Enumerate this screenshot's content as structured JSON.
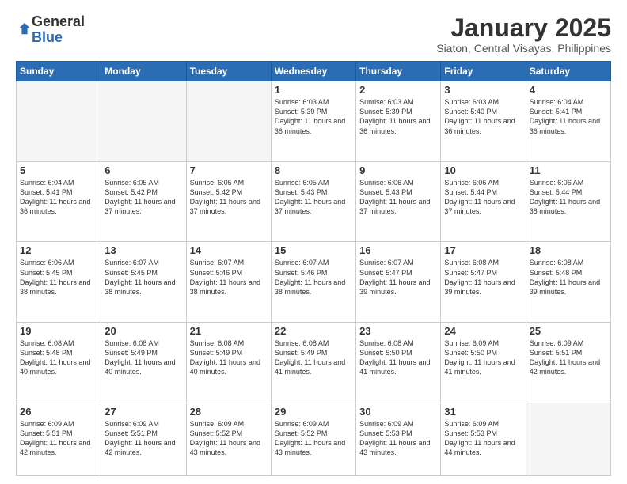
{
  "logo": {
    "general": "General",
    "blue": "Blue"
  },
  "header": {
    "title": "January 2025",
    "location": "Siaton, Central Visayas, Philippines"
  },
  "weekdays": [
    "Sunday",
    "Monday",
    "Tuesday",
    "Wednesday",
    "Thursday",
    "Friday",
    "Saturday"
  ],
  "weeks": [
    [
      {
        "day": "",
        "sunrise": "",
        "sunset": "",
        "daylight": ""
      },
      {
        "day": "",
        "sunrise": "",
        "sunset": "",
        "daylight": ""
      },
      {
        "day": "",
        "sunrise": "",
        "sunset": "",
        "daylight": ""
      },
      {
        "day": "1",
        "sunrise": "Sunrise: 6:03 AM",
        "sunset": "Sunset: 5:39 PM",
        "daylight": "Daylight: 11 hours and 36 minutes."
      },
      {
        "day": "2",
        "sunrise": "Sunrise: 6:03 AM",
        "sunset": "Sunset: 5:39 PM",
        "daylight": "Daylight: 11 hours and 36 minutes."
      },
      {
        "day": "3",
        "sunrise": "Sunrise: 6:03 AM",
        "sunset": "Sunset: 5:40 PM",
        "daylight": "Daylight: 11 hours and 36 minutes."
      },
      {
        "day": "4",
        "sunrise": "Sunrise: 6:04 AM",
        "sunset": "Sunset: 5:41 PM",
        "daylight": "Daylight: 11 hours and 36 minutes."
      }
    ],
    [
      {
        "day": "5",
        "sunrise": "Sunrise: 6:04 AM",
        "sunset": "Sunset: 5:41 PM",
        "daylight": "Daylight: 11 hours and 36 minutes."
      },
      {
        "day": "6",
        "sunrise": "Sunrise: 6:05 AM",
        "sunset": "Sunset: 5:42 PM",
        "daylight": "Daylight: 11 hours and 37 minutes."
      },
      {
        "day": "7",
        "sunrise": "Sunrise: 6:05 AM",
        "sunset": "Sunset: 5:42 PM",
        "daylight": "Daylight: 11 hours and 37 minutes."
      },
      {
        "day": "8",
        "sunrise": "Sunrise: 6:05 AM",
        "sunset": "Sunset: 5:43 PM",
        "daylight": "Daylight: 11 hours and 37 minutes."
      },
      {
        "day": "9",
        "sunrise": "Sunrise: 6:06 AM",
        "sunset": "Sunset: 5:43 PM",
        "daylight": "Daylight: 11 hours and 37 minutes."
      },
      {
        "day": "10",
        "sunrise": "Sunrise: 6:06 AM",
        "sunset": "Sunset: 5:44 PM",
        "daylight": "Daylight: 11 hours and 37 minutes."
      },
      {
        "day": "11",
        "sunrise": "Sunrise: 6:06 AM",
        "sunset": "Sunset: 5:44 PM",
        "daylight": "Daylight: 11 hours and 38 minutes."
      }
    ],
    [
      {
        "day": "12",
        "sunrise": "Sunrise: 6:06 AM",
        "sunset": "Sunset: 5:45 PM",
        "daylight": "Daylight: 11 hours and 38 minutes."
      },
      {
        "day": "13",
        "sunrise": "Sunrise: 6:07 AM",
        "sunset": "Sunset: 5:45 PM",
        "daylight": "Daylight: 11 hours and 38 minutes."
      },
      {
        "day": "14",
        "sunrise": "Sunrise: 6:07 AM",
        "sunset": "Sunset: 5:46 PM",
        "daylight": "Daylight: 11 hours and 38 minutes."
      },
      {
        "day": "15",
        "sunrise": "Sunrise: 6:07 AM",
        "sunset": "Sunset: 5:46 PM",
        "daylight": "Daylight: 11 hours and 38 minutes."
      },
      {
        "day": "16",
        "sunrise": "Sunrise: 6:07 AM",
        "sunset": "Sunset: 5:47 PM",
        "daylight": "Daylight: 11 hours and 39 minutes."
      },
      {
        "day": "17",
        "sunrise": "Sunrise: 6:08 AM",
        "sunset": "Sunset: 5:47 PM",
        "daylight": "Daylight: 11 hours and 39 minutes."
      },
      {
        "day": "18",
        "sunrise": "Sunrise: 6:08 AM",
        "sunset": "Sunset: 5:48 PM",
        "daylight": "Daylight: 11 hours and 39 minutes."
      }
    ],
    [
      {
        "day": "19",
        "sunrise": "Sunrise: 6:08 AM",
        "sunset": "Sunset: 5:48 PM",
        "daylight": "Daylight: 11 hours and 40 minutes."
      },
      {
        "day": "20",
        "sunrise": "Sunrise: 6:08 AM",
        "sunset": "Sunset: 5:49 PM",
        "daylight": "Daylight: 11 hours and 40 minutes."
      },
      {
        "day": "21",
        "sunrise": "Sunrise: 6:08 AM",
        "sunset": "Sunset: 5:49 PM",
        "daylight": "Daylight: 11 hours and 40 minutes."
      },
      {
        "day": "22",
        "sunrise": "Sunrise: 6:08 AM",
        "sunset": "Sunset: 5:49 PM",
        "daylight": "Daylight: 11 hours and 41 minutes."
      },
      {
        "day": "23",
        "sunrise": "Sunrise: 6:08 AM",
        "sunset": "Sunset: 5:50 PM",
        "daylight": "Daylight: 11 hours and 41 minutes."
      },
      {
        "day": "24",
        "sunrise": "Sunrise: 6:09 AM",
        "sunset": "Sunset: 5:50 PM",
        "daylight": "Daylight: 11 hours and 41 minutes."
      },
      {
        "day": "25",
        "sunrise": "Sunrise: 6:09 AM",
        "sunset": "Sunset: 5:51 PM",
        "daylight": "Daylight: 11 hours and 42 minutes."
      }
    ],
    [
      {
        "day": "26",
        "sunrise": "Sunrise: 6:09 AM",
        "sunset": "Sunset: 5:51 PM",
        "daylight": "Daylight: 11 hours and 42 minutes."
      },
      {
        "day": "27",
        "sunrise": "Sunrise: 6:09 AM",
        "sunset": "Sunset: 5:51 PM",
        "daylight": "Daylight: 11 hours and 42 minutes."
      },
      {
        "day": "28",
        "sunrise": "Sunrise: 6:09 AM",
        "sunset": "Sunset: 5:52 PM",
        "daylight": "Daylight: 11 hours and 43 minutes."
      },
      {
        "day": "29",
        "sunrise": "Sunrise: 6:09 AM",
        "sunset": "Sunset: 5:52 PM",
        "daylight": "Daylight: 11 hours and 43 minutes."
      },
      {
        "day": "30",
        "sunrise": "Sunrise: 6:09 AM",
        "sunset": "Sunset: 5:53 PM",
        "daylight": "Daylight: 11 hours and 43 minutes."
      },
      {
        "day": "31",
        "sunrise": "Sunrise: 6:09 AM",
        "sunset": "Sunset: 5:53 PM",
        "daylight": "Daylight: 11 hours and 44 minutes."
      },
      {
        "day": "",
        "sunrise": "",
        "sunset": "",
        "daylight": ""
      }
    ]
  ]
}
